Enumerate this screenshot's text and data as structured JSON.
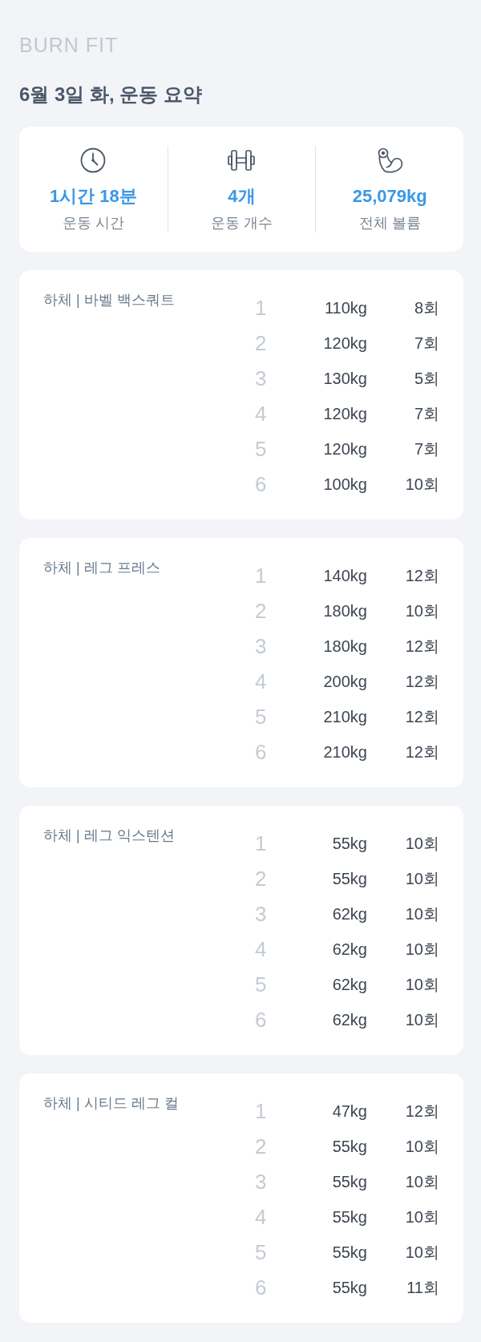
{
  "app": {
    "logo": "BURN FIT"
  },
  "title": "6월 3일 화, 운동 요약",
  "summary": [
    {
      "kind": "duration",
      "value": "1시간 18분",
      "label": "운동 시간"
    },
    {
      "kind": "count",
      "value": "4개",
      "label": "운동 개수"
    },
    {
      "kind": "volume",
      "value": "25,079kg",
      "label": "전체 볼륨"
    }
  ],
  "exercises": [
    {
      "name": "하체 | 바벨 백스쿼트",
      "sets": [
        {
          "number": "1",
          "weight": "110kg",
          "reps": "8회"
        },
        {
          "number": "2",
          "weight": "120kg",
          "reps": "7회"
        },
        {
          "number": "3",
          "weight": "130kg",
          "reps": "5회"
        },
        {
          "number": "4",
          "weight": "120kg",
          "reps": "7회"
        },
        {
          "number": "5",
          "weight": "120kg",
          "reps": "7회"
        },
        {
          "number": "6",
          "weight": "100kg",
          "reps": "10회"
        }
      ]
    },
    {
      "name": "하체 | 레그 프레스",
      "sets": [
        {
          "number": "1",
          "weight": "140kg",
          "reps": "12회"
        },
        {
          "number": "2",
          "weight": "180kg",
          "reps": "10회"
        },
        {
          "number": "3",
          "weight": "180kg",
          "reps": "12회"
        },
        {
          "number": "4",
          "weight": "200kg",
          "reps": "12회"
        },
        {
          "number": "5",
          "weight": "210kg",
          "reps": "12회"
        },
        {
          "number": "6",
          "weight": "210kg",
          "reps": "12회"
        }
      ]
    },
    {
      "name": "하체 | 레그 익스텐션",
      "sets": [
        {
          "number": "1",
          "weight": "55kg",
          "reps": "10회"
        },
        {
          "number": "2",
          "weight": "55kg",
          "reps": "10회"
        },
        {
          "number": "3",
          "weight": "62kg",
          "reps": "10회"
        },
        {
          "number": "4",
          "weight": "62kg",
          "reps": "10회"
        },
        {
          "number": "5",
          "weight": "62kg",
          "reps": "10회"
        },
        {
          "number": "6",
          "weight": "62kg",
          "reps": "10회"
        }
      ]
    },
    {
      "name": "하체 | 시티드 레그 컬",
      "sets": [
        {
          "number": "1",
          "weight": "47kg",
          "reps": "12회"
        },
        {
          "number": "2",
          "weight": "55kg",
          "reps": "10회"
        },
        {
          "number": "3",
          "weight": "55kg",
          "reps": "10회"
        },
        {
          "number": "4",
          "weight": "55kg",
          "reps": "10회"
        },
        {
          "number": "5",
          "weight": "55kg",
          "reps": "10회"
        },
        {
          "number": "6",
          "weight": "55kg",
          "reps": "11회"
        }
      ]
    }
  ]
}
